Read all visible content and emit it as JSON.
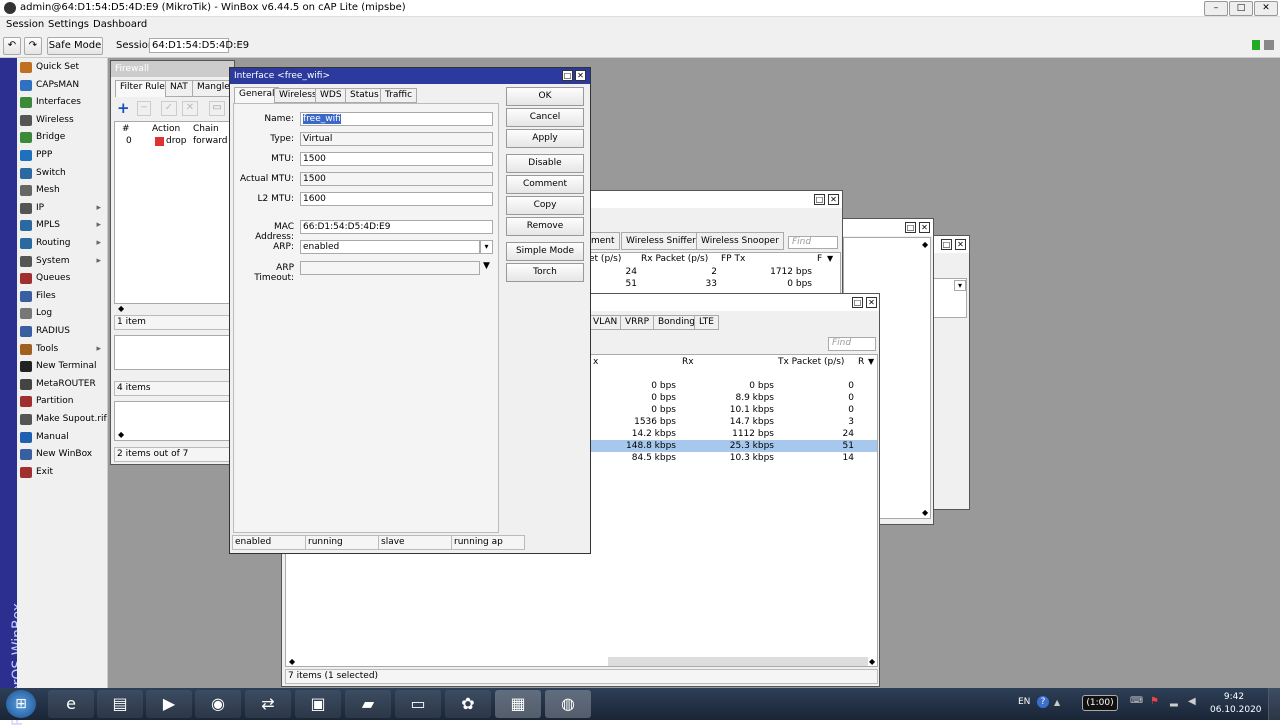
{
  "window": {
    "title": "admin@64:D1:54:D5:4D:E9 (MikroTik) - WinBox v6.44.5 on cAP Lite (mipsbe)"
  },
  "menu": [
    "Session",
    "Settings",
    "Dashboard"
  ],
  "toolbar": {
    "safe_mode": "Safe Mode",
    "session_label": "Session:",
    "session_value": "64:D1:54:D5:4D:E9"
  },
  "brand_vertical": "RouterOS WinBox",
  "sidebar": [
    {
      "label": "Quick Set",
      "icon": "quick-set-icon",
      "color": "#c07020"
    },
    {
      "label": "CAPsMAN",
      "icon": "capsman-icon",
      "color": "#3070c0"
    },
    {
      "label": "Interfaces",
      "icon": "interfaces-icon",
      "color": "#3a8a3a"
    },
    {
      "label": "Wireless",
      "icon": "wireless-icon",
      "color": "#555555"
    },
    {
      "label": "Bridge",
      "icon": "bridge-icon",
      "color": "#3a8a3a"
    },
    {
      "label": "PPP",
      "icon": "ppp-icon",
      "color": "#2070c0"
    },
    {
      "label": "Switch",
      "icon": "switch-icon",
      "color": "#2a6aa0"
    },
    {
      "label": "Mesh",
      "icon": "mesh-icon",
      "color": "#666666"
    },
    {
      "label": "IP",
      "icon": "ip-icon",
      "color": "#555555",
      "arrow": true
    },
    {
      "label": "MPLS",
      "icon": "mpls-icon",
      "color": "#2a6aa0",
      "arrow": true
    },
    {
      "label": "Routing",
      "icon": "routing-icon",
      "color": "#2a6aa0",
      "arrow": true
    },
    {
      "label": "System",
      "icon": "system-icon",
      "color": "#555555",
      "arrow": true
    },
    {
      "label": "Queues",
      "icon": "queues-icon",
      "color": "#a03030"
    },
    {
      "label": "Files",
      "icon": "files-icon",
      "color": "#3a5fa0"
    },
    {
      "label": "Log",
      "icon": "log-icon",
      "color": "#777777"
    },
    {
      "label": "RADIUS",
      "icon": "radius-icon",
      "color": "#3a5fa0"
    },
    {
      "label": "Tools",
      "icon": "tools-icon",
      "color": "#a06020",
      "arrow": true
    },
    {
      "label": "New Terminal",
      "icon": "terminal-icon",
      "color": "#222222"
    },
    {
      "label": "MetaROUTER",
      "icon": "metarouter-icon",
      "color": "#444444"
    },
    {
      "label": "Partition",
      "icon": "partition-icon",
      "color": "#a03030"
    },
    {
      "label": "Make Supout.rif",
      "icon": "supout-icon",
      "color": "#555555"
    },
    {
      "label": "Manual",
      "icon": "manual-icon",
      "color": "#2060b0"
    },
    {
      "label": "New WinBox",
      "icon": "winbox-icon",
      "color": "#3a5fa0"
    },
    {
      "label": "Exit",
      "icon": "exit-icon",
      "color": "#a03030"
    }
  ],
  "firewall": {
    "title": "Firewall",
    "tabs": [
      "Filter Rules",
      "NAT",
      "Mangle"
    ],
    "columns": [
      "#",
      "Action",
      "Chain"
    ],
    "row": {
      "num": "0",
      "action": "drop",
      "chain": "forward"
    },
    "status1": "1 item",
    "status2": "4 items",
    "status3": "2 items out of 7"
  },
  "wireless_win": {
    "tabs": [
      "ment",
      "Wireless Sniffer",
      "Wireless Snooper"
    ],
    "find": "Find",
    "columns": [
      "et (p/s)",
      "Rx Packet (p/s)",
      "FP Tx",
      "F"
    ],
    "rows": [
      [
        "24",
        "2",
        "1712 bps"
      ],
      [
        "51",
        "33",
        "0 bps"
      ]
    ]
  },
  "interfaces_win": {
    "tabs": [
      "VLAN",
      "VRRP",
      "Bonding",
      "LTE"
    ],
    "find": "Find",
    "columns": [
      "x",
      "Rx",
      "Tx Packet (p/s)",
      "R"
    ],
    "rows": [
      [
        "0 bps",
        "0 bps",
        "0"
      ],
      [
        "0 bps",
        "8.9 kbps",
        "0"
      ],
      [
        "0 bps",
        "10.1 kbps",
        "0"
      ],
      [
        "1536 bps",
        "14.7 kbps",
        "3"
      ],
      [
        "14.2 kbps",
        "1112 bps",
        "24"
      ],
      [
        "148.8 kbps",
        "25.3 kbps",
        "51"
      ],
      [
        "84.5 kbps",
        "10.3 kbps",
        "14"
      ]
    ],
    "selected_row": 5,
    "status": "7 items (1 selected)"
  },
  "dialog": {
    "title": "Interface <free_wifi>",
    "tabs": [
      "General",
      "Wireless",
      "WDS",
      "Status",
      "Traffic"
    ],
    "fields": {
      "name_label": "Name:",
      "name": "free_wifi",
      "type_label": "Type:",
      "type": "Virtual",
      "mtu_label": "MTU:",
      "mtu": "1500",
      "actual_mtu_label": "Actual MTU:",
      "actual_mtu": "1500",
      "l2mtu_label": "L2 MTU:",
      "l2mtu": "1600",
      "mac_label": "MAC Address:",
      "mac": "66:D1:54:D5:4D:E9",
      "arp_label": "ARP:",
      "arp": "enabled",
      "arp_timeout_label": "ARP Timeout:",
      "arp_timeout": ""
    },
    "buttons": [
      "OK",
      "Cancel",
      "Apply",
      "Disable",
      "Comment",
      "Copy",
      "Remove",
      "Simple Mode",
      "Torch"
    ],
    "status": [
      "enabled",
      "running",
      "slave",
      "running ap"
    ]
  },
  "tray": {
    "lang": "EN",
    "time": "9:42",
    "date": "06.10.2020",
    "timer": "(1:00)"
  }
}
